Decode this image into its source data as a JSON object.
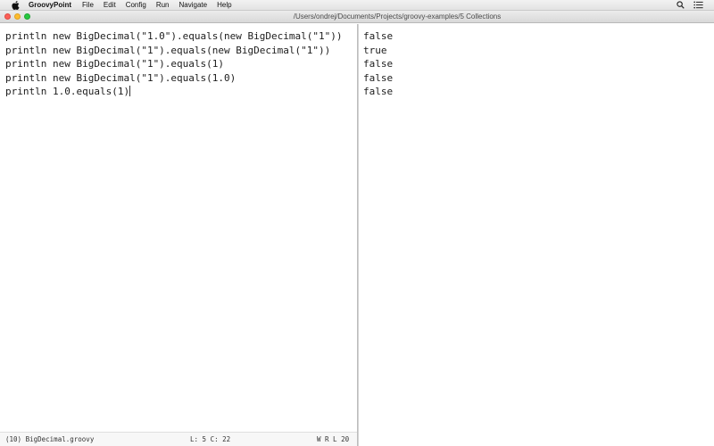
{
  "menubar": {
    "app_name": "GroovyPoint",
    "items": [
      "File",
      "Edit",
      "Config",
      "Run",
      "Navigate",
      "Help"
    ]
  },
  "window": {
    "title": "/Users/ondrej/Documents/Projects/groovy-examples/5 Collections"
  },
  "editor": {
    "lines": [
      "println new BigDecimal(\"1.0\").equals(new BigDecimal(\"1\"))",
      "println new BigDecimal(\"1\").equals(new BigDecimal(\"1\"))",
      "println new BigDecimal(\"1\").equals(1)",
      "println new BigDecimal(\"1\").equals(1.0)",
      "println 1.0.equals(1)"
    ]
  },
  "output": {
    "lines": [
      "false",
      "true",
      "false",
      "false",
      "false"
    ]
  },
  "status": {
    "file": "(10) BigDecimal.groovy",
    "position": "L: 5 C: 22",
    "flags": "W R L 20"
  },
  "colors": {
    "close": "#fc5f57",
    "minimize": "#fdbc2e",
    "zoom": "#28c840"
  },
  "icons": {
    "menubar_left": "apple-icon",
    "menubar_right": [
      "search-icon",
      "list-icon"
    ]
  }
}
